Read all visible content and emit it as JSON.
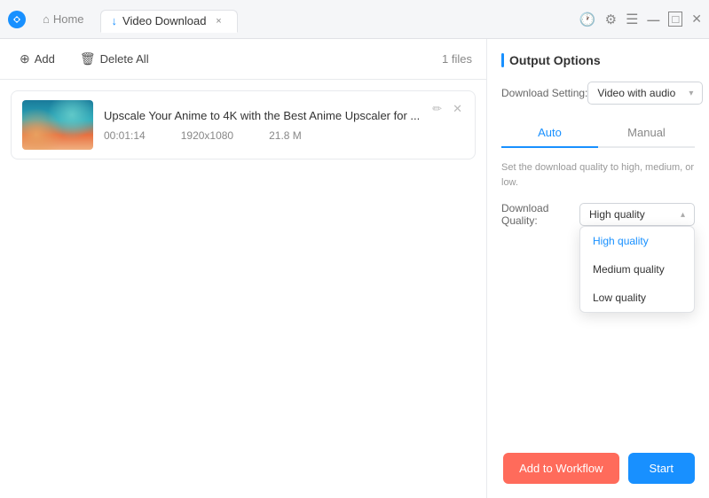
{
  "titlebar": {
    "home_label": "Home",
    "active_tab_label": "Video Download",
    "close_tab_label": "×"
  },
  "toolbar": {
    "add_label": "Add",
    "delete_label": "Delete All",
    "file_count": "1 files"
  },
  "file_item": {
    "title": "Upscale Your Anime to 4K with the Best Anime Upscaler for ...",
    "duration": "00:01:14",
    "resolution": "1920x1080",
    "size": "21.8 M"
  },
  "right_panel": {
    "section_title": "Output Options",
    "download_setting_label": "Download Setting:",
    "download_setting_value": "Video with audio",
    "tab_auto": "Auto",
    "tab_manual": "Manual",
    "quality_desc": "Set the download quality to high, medium, or low.",
    "quality_label": "Download Quality:",
    "quality_selected": "High quality",
    "quality_options": [
      {
        "label": "High quality",
        "value": "high"
      },
      {
        "label": "Medium quality",
        "value": "medium"
      },
      {
        "label": "Low quality",
        "value": "low"
      }
    ]
  },
  "buttons": {
    "add_to_workflow": "Add to Workflow",
    "start": "Start"
  },
  "icons": {
    "clock": "🕐",
    "settings": "⚙",
    "menu": "☰",
    "minimize": "—",
    "maximize": "□",
    "close": "✕",
    "home": "🏠",
    "download": "⬇",
    "add": "⊕",
    "trash": "🗑",
    "edit": "✏",
    "remove": "✕",
    "chevron_down": "▾",
    "chevron_up": "▴"
  }
}
